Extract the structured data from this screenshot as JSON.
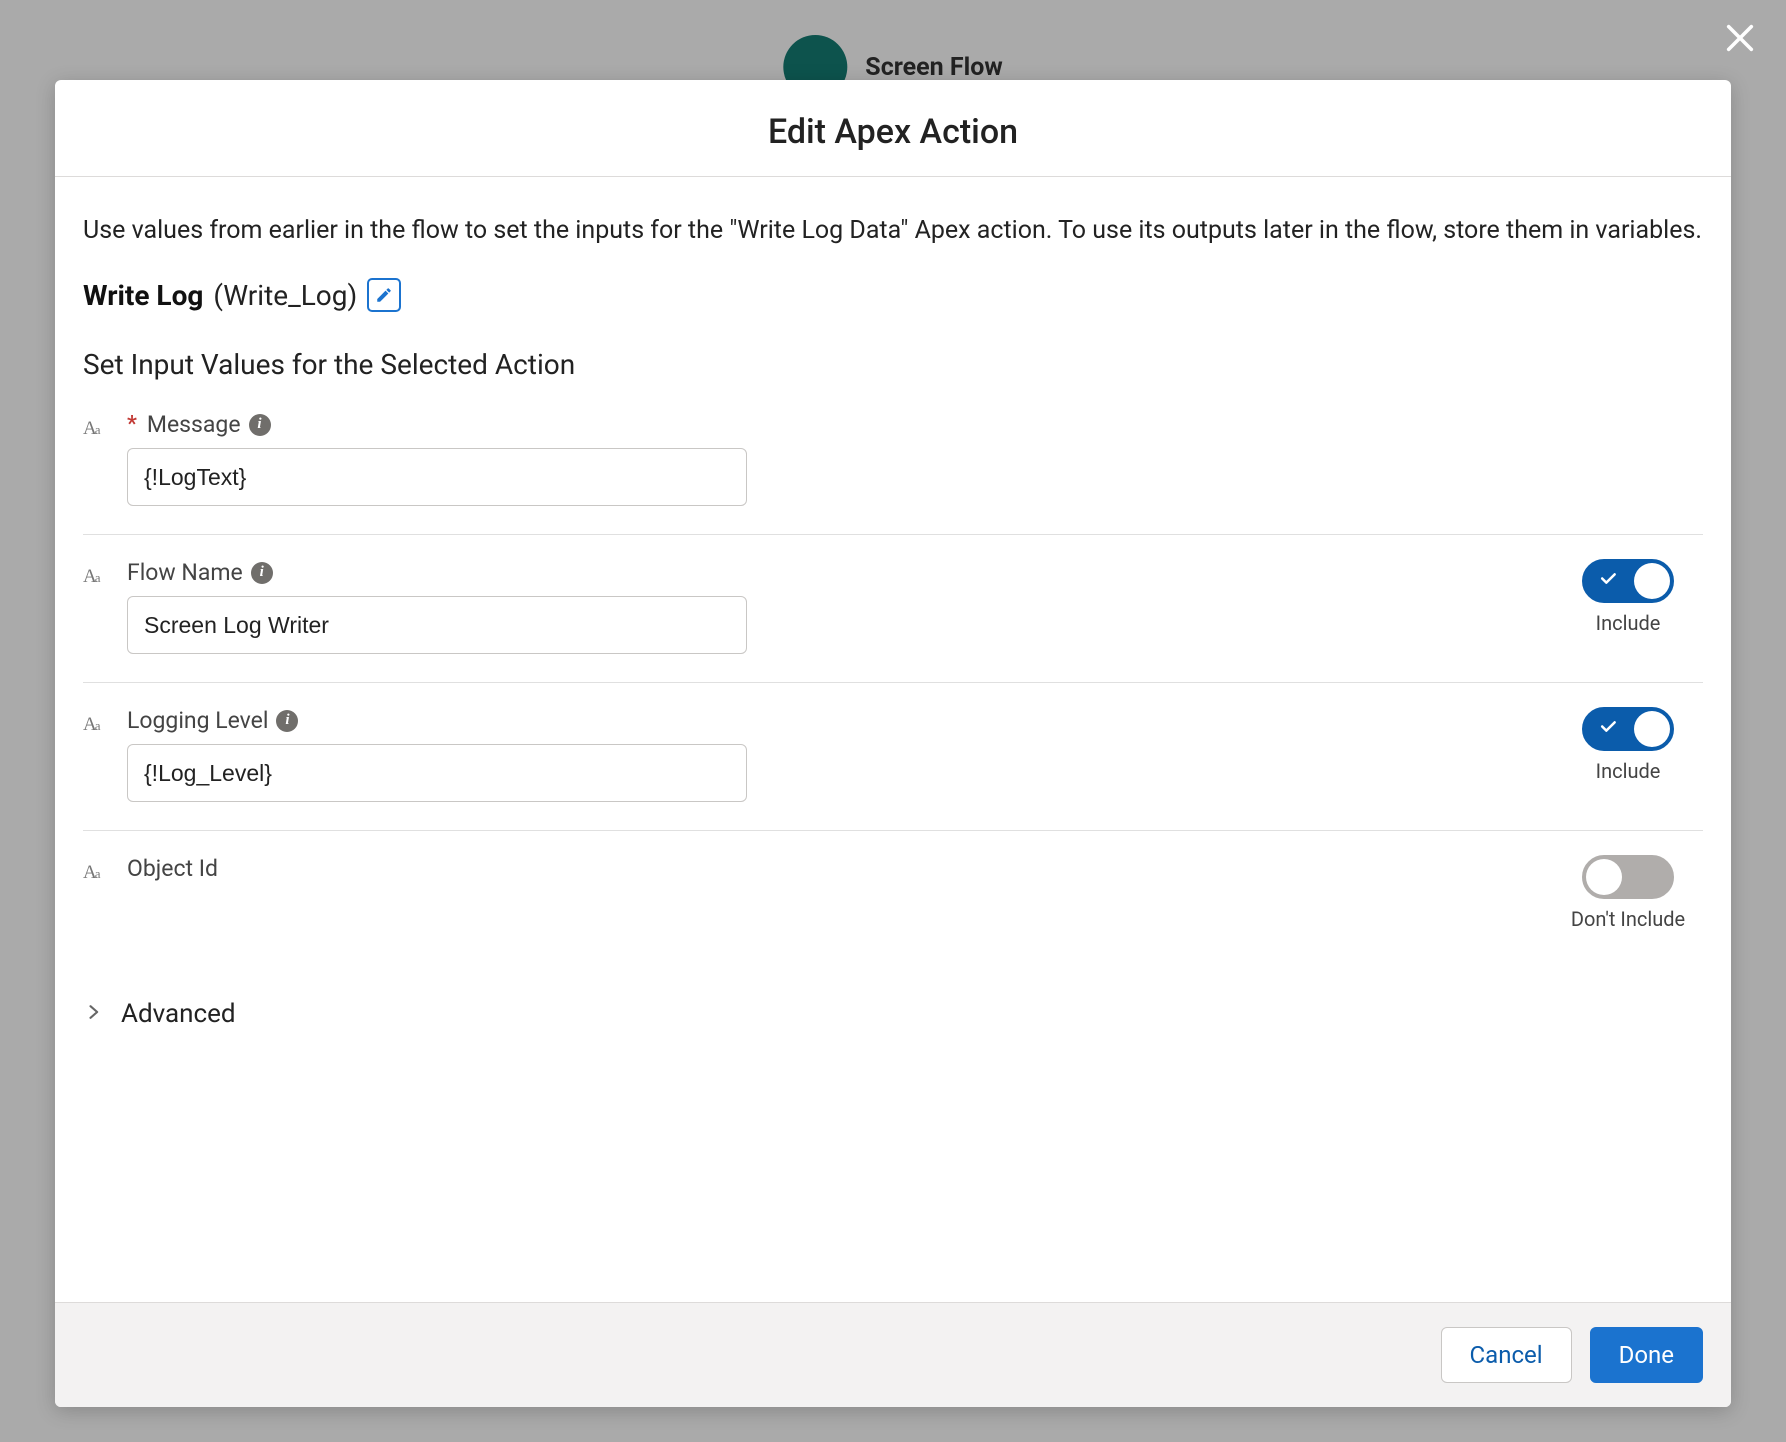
{
  "background": {
    "flow_type_label": "Screen Flow"
  },
  "modal": {
    "title": "Edit Apex Action",
    "help_text": "Use values from earlier in the flow to set the inputs for the \"Write Log Data\" Apex action. To use its outputs later in the flow, store them in variables.",
    "entity": {
      "label": "Write Log",
      "api_name": "(Write_Log)"
    },
    "section_heading": "Set Input Values for the Selected Action",
    "inputs": {
      "message": {
        "label": "Message",
        "value": "{!LogText}",
        "required": true
      },
      "flow_name": {
        "label": "Flow Name",
        "value": "Screen Log Writer",
        "toggle_on": true,
        "toggle_label": "Include"
      },
      "logging_level": {
        "label": "Logging Level",
        "value": "{!Log_Level}",
        "toggle_on": true,
        "toggle_label": "Include"
      },
      "object_id": {
        "label": "Object Id",
        "toggle_on": false,
        "toggle_label": "Don't Include"
      }
    },
    "advanced_label": "Advanced",
    "footer": {
      "cancel": "Cancel",
      "done": "Done"
    }
  }
}
